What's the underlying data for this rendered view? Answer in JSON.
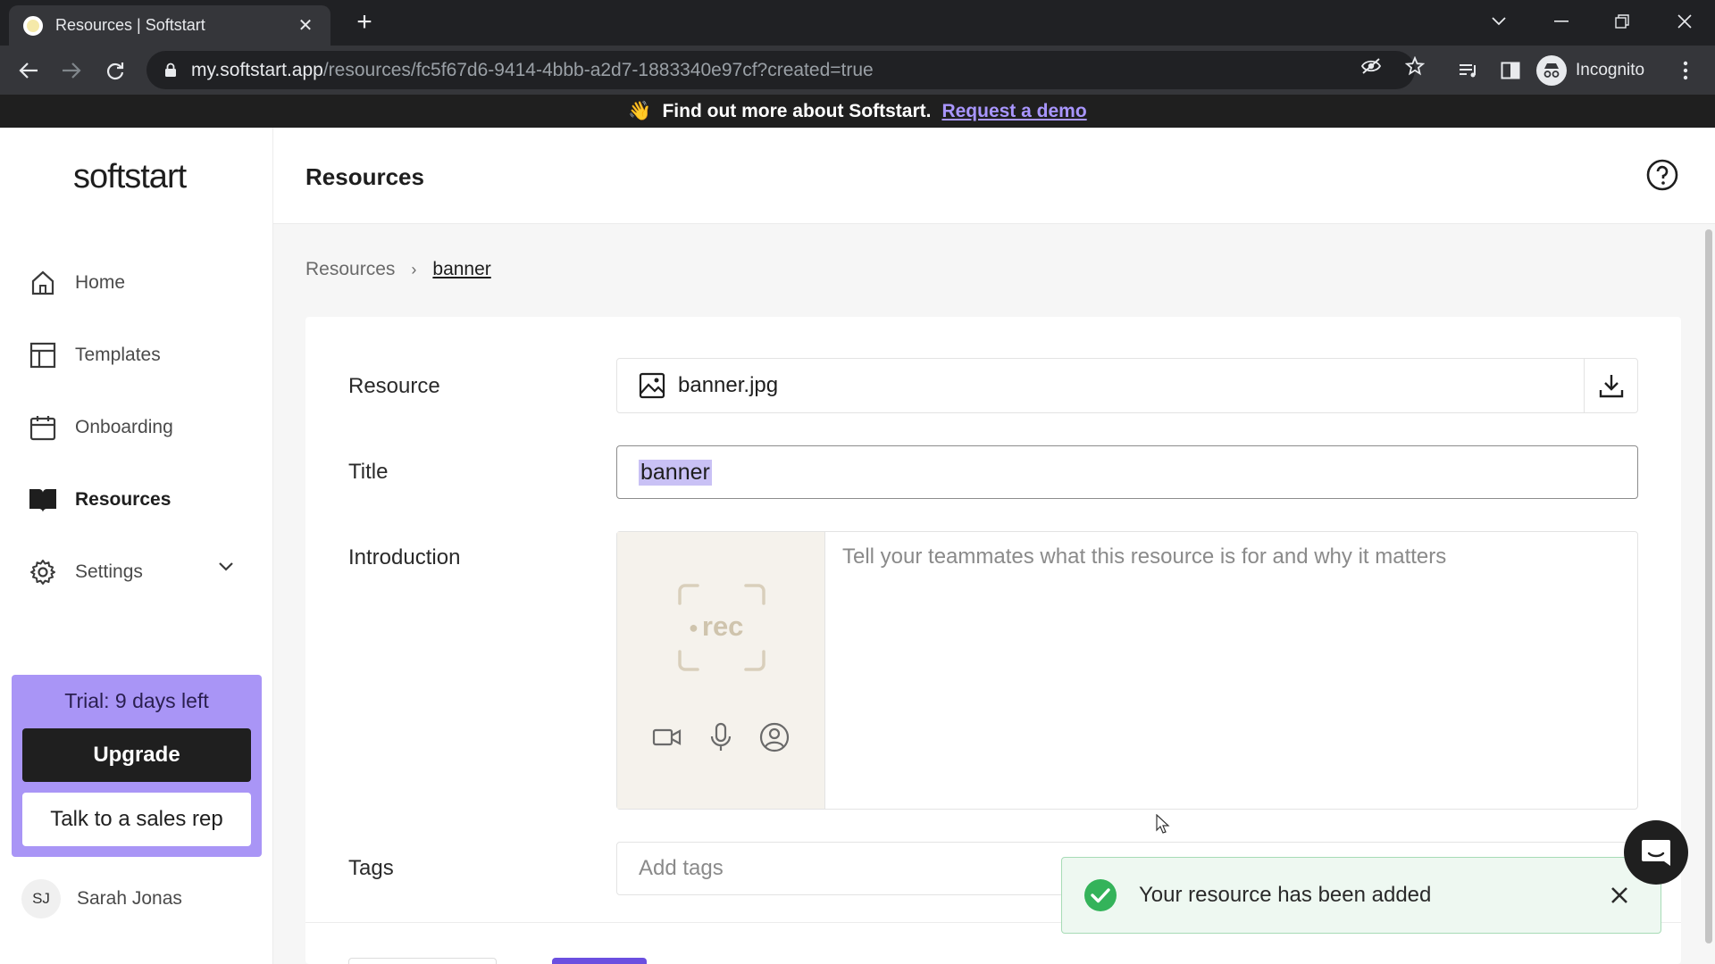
{
  "browser": {
    "tab_title": "Resources | Softstart",
    "url_host": "my.softstart.app",
    "url_path": "/resources/fc5f67d6-9414-4bbb-a2d7-1883340e97cf?created=true",
    "profile_label": "Incognito"
  },
  "announcement": {
    "emoji": "👋",
    "text": "Find out more about Softstart.",
    "link": "Request a demo"
  },
  "sidebar": {
    "logo": "softstart",
    "items": [
      {
        "label": "Home",
        "icon": "home-icon"
      },
      {
        "label": "Templates",
        "icon": "templates-icon"
      },
      {
        "label": "Onboarding",
        "icon": "calendar-icon"
      },
      {
        "label": "Resources",
        "icon": "book-icon",
        "active": true
      },
      {
        "label": "Settings",
        "icon": "gear-icon"
      }
    ],
    "trial": {
      "text": "Trial: 9 days left",
      "upgrade_label": "Upgrade",
      "sales_label": "Talk to a sales rep"
    },
    "user": {
      "initials": "SJ",
      "name": "Sarah Jonas"
    }
  },
  "main": {
    "title": "Resources",
    "breadcrumb": {
      "parent": "Resources",
      "separator": "›",
      "current": "banner"
    },
    "form": {
      "resource_label": "Resource",
      "resource_file": "banner.jpg",
      "title_label": "Title",
      "title_value": "banner",
      "intro_label": "Introduction",
      "intro_placeholder": "Tell your teammates what this resource is for and why it matters",
      "rec_label": "rec",
      "tags_label": "Tags",
      "tags_placeholder": "Add tags"
    }
  },
  "toast": {
    "message": "Your resource has been added"
  },
  "colors": {
    "accent": "#6b4fe0",
    "trial_bg": "#a995f6",
    "selection": "#c9c1f5",
    "success": "#34b35a"
  }
}
